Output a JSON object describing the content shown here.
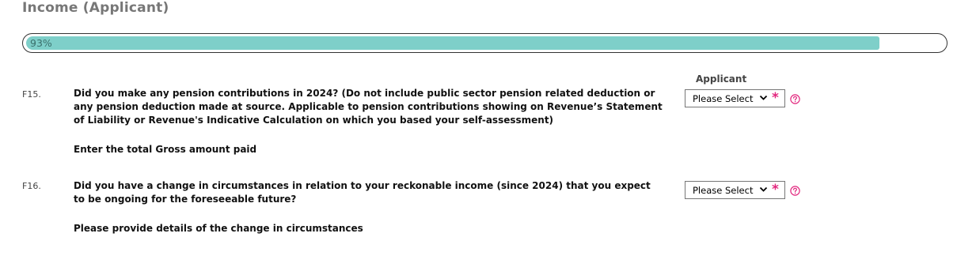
{
  "section": {
    "title": "Income (Applicant)"
  },
  "progress": {
    "label": "93%",
    "value": 93
  },
  "columns": {
    "applicant_label": "Applicant"
  },
  "questions": [
    {
      "number": "F15.",
      "text": "Did you make any pension contributions in 2024? (Do not include public sector pension related deduction or any pension deduction made at source. Applicable to pension contributions showing on Revenue’s Statement of Liability or Revenue's Indicative Calculation on which you based your self-assessment)",
      "subtext": "Enter the total Gross amount paid",
      "select_value": "Please Select",
      "required_mark": "*",
      "help_icon": "question-circle-icon"
    },
    {
      "number": "F16.",
      "text": "Did you have a change in circumstances in relation to your reckonable income (since 2024) that you expect to be ongoing for the foreseeable future?",
      "subtext": "Please provide details of the change in circumstances",
      "select_value": "Please Select",
      "required_mark": "*",
      "help_icon": "question-circle-icon"
    }
  ],
  "colors": {
    "progress_fill": "#7ecfc9",
    "required": "#e2277e",
    "title": "#777777"
  }
}
